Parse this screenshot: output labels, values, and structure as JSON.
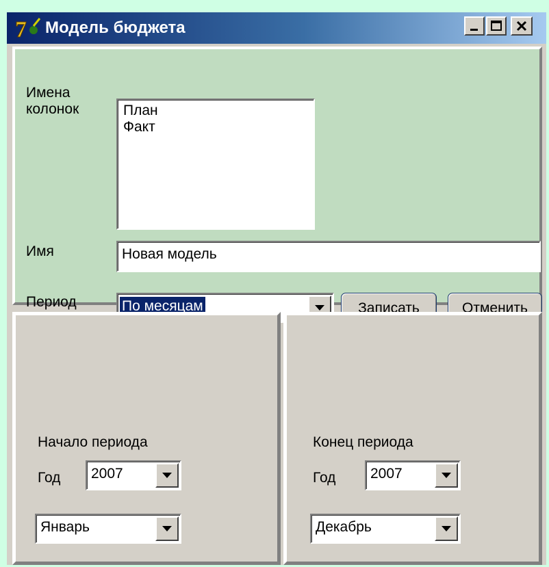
{
  "window": {
    "title": "Модель бюджета"
  },
  "columns": {
    "label": "Имена колонок",
    "label_line1": "Имена",
    "label_line2": "колонок",
    "items": [
      "План",
      "Факт"
    ]
  },
  "name": {
    "label": "Имя",
    "value": "Новая модель"
  },
  "period": {
    "label": "Период",
    "selected": "По месяцам"
  },
  "buttons": {
    "save": "Записать",
    "cancel": "Отменить"
  },
  "start": {
    "title": "Начало периода",
    "year_label": "Год",
    "year": "2007",
    "month": "Январь"
  },
  "end": {
    "title": "Конец периода",
    "year_label": "Год",
    "year": "2007",
    "month": "Декабрь"
  },
  "colors": {
    "background": "#cfffe4",
    "top_panel": "#c0dcc0",
    "face": "#d4d0c8",
    "titlebar": "#0a246a",
    "selection": "#0a246a"
  },
  "icons": {
    "app": "app-icon-7",
    "minimize": "minimize-icon",
    "maximize": "maximize-icon",
    "close": "close-icon",
    "dropdown": "chevron-down-icon"
  }
}
